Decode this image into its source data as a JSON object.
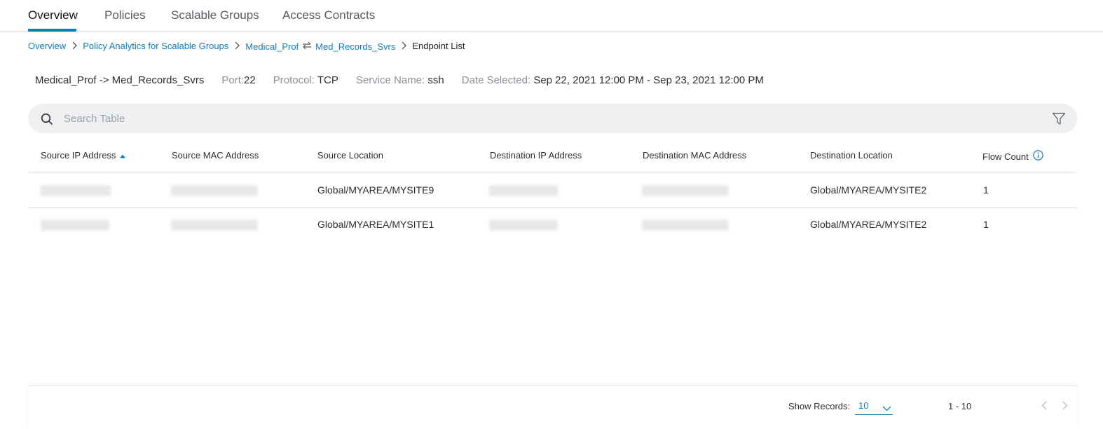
{
  "tabs": [
    {
      "label": "Overview",
      "active": true
    },
    {
      "label": "Policies",
      "active": false
    },
    {
      "label": "Scalable Groups",
      "active": false
    },
    {
      "label": "Access Contracts",
      "active": false
    }
  ],
  "breadcrumb": {
    "overview": "Overview",
    "policy_analytics": "Policy Analytics for Scalable Groups",
    "source_group": "Medical_Prof",
    "destination_group": "Med_Records_Svrs",
    "current": "Endpoint List"
  },
  "summary": {
    "flow": "Medical_Prof -> Med_Records_Svrs",
    "port_label": "Port:",
    "port_value": "22",
    "protocol_label": "Protocol:",
    "protocol_value": "TCP",
    "service_label": "Service Name:",
    "service_value": "ssh",
    "date_label": "Date Selected:",
    "date_value": "Sep 22, 2021 12:00 PM - Sep 23, 2021 12:00 PM"
  },
  "search": {
    "placeholder": "Search Table"
  },
  "table": {
    "columns": [
      "Source IP Address",
      "Source MAC Address",
      "Source Location",
      "Destination IP Address",
      "Destination MAC Address",
      "Destination Location",
      "Flow Count"
    ],
    "sorted_column": "Source IP Address",
    "rows": [
      {
        "source_location": "Global/MYAREA/MYSITE9",
        "destination_location": "Global/MYAREA/MYSITE2",
        "flow_count": "1"
      },
      {
        "source_location": "Global/MYAREA/MYSITE1",
        "destination_location": "Global/MYAREA/MYSITE2",
        "flow_count": "1"
      }
    ]
  },
  "footer": {
    "show_records_label": "Show Records:",
    "show_records_value": "10",
    "range": "1 - 10"
  },
  "colors": {
    "accent": "#0d7ebd",
    "search_bg": "#eff0f1",
    "muted_text": "#8a8f95"
  }
}
